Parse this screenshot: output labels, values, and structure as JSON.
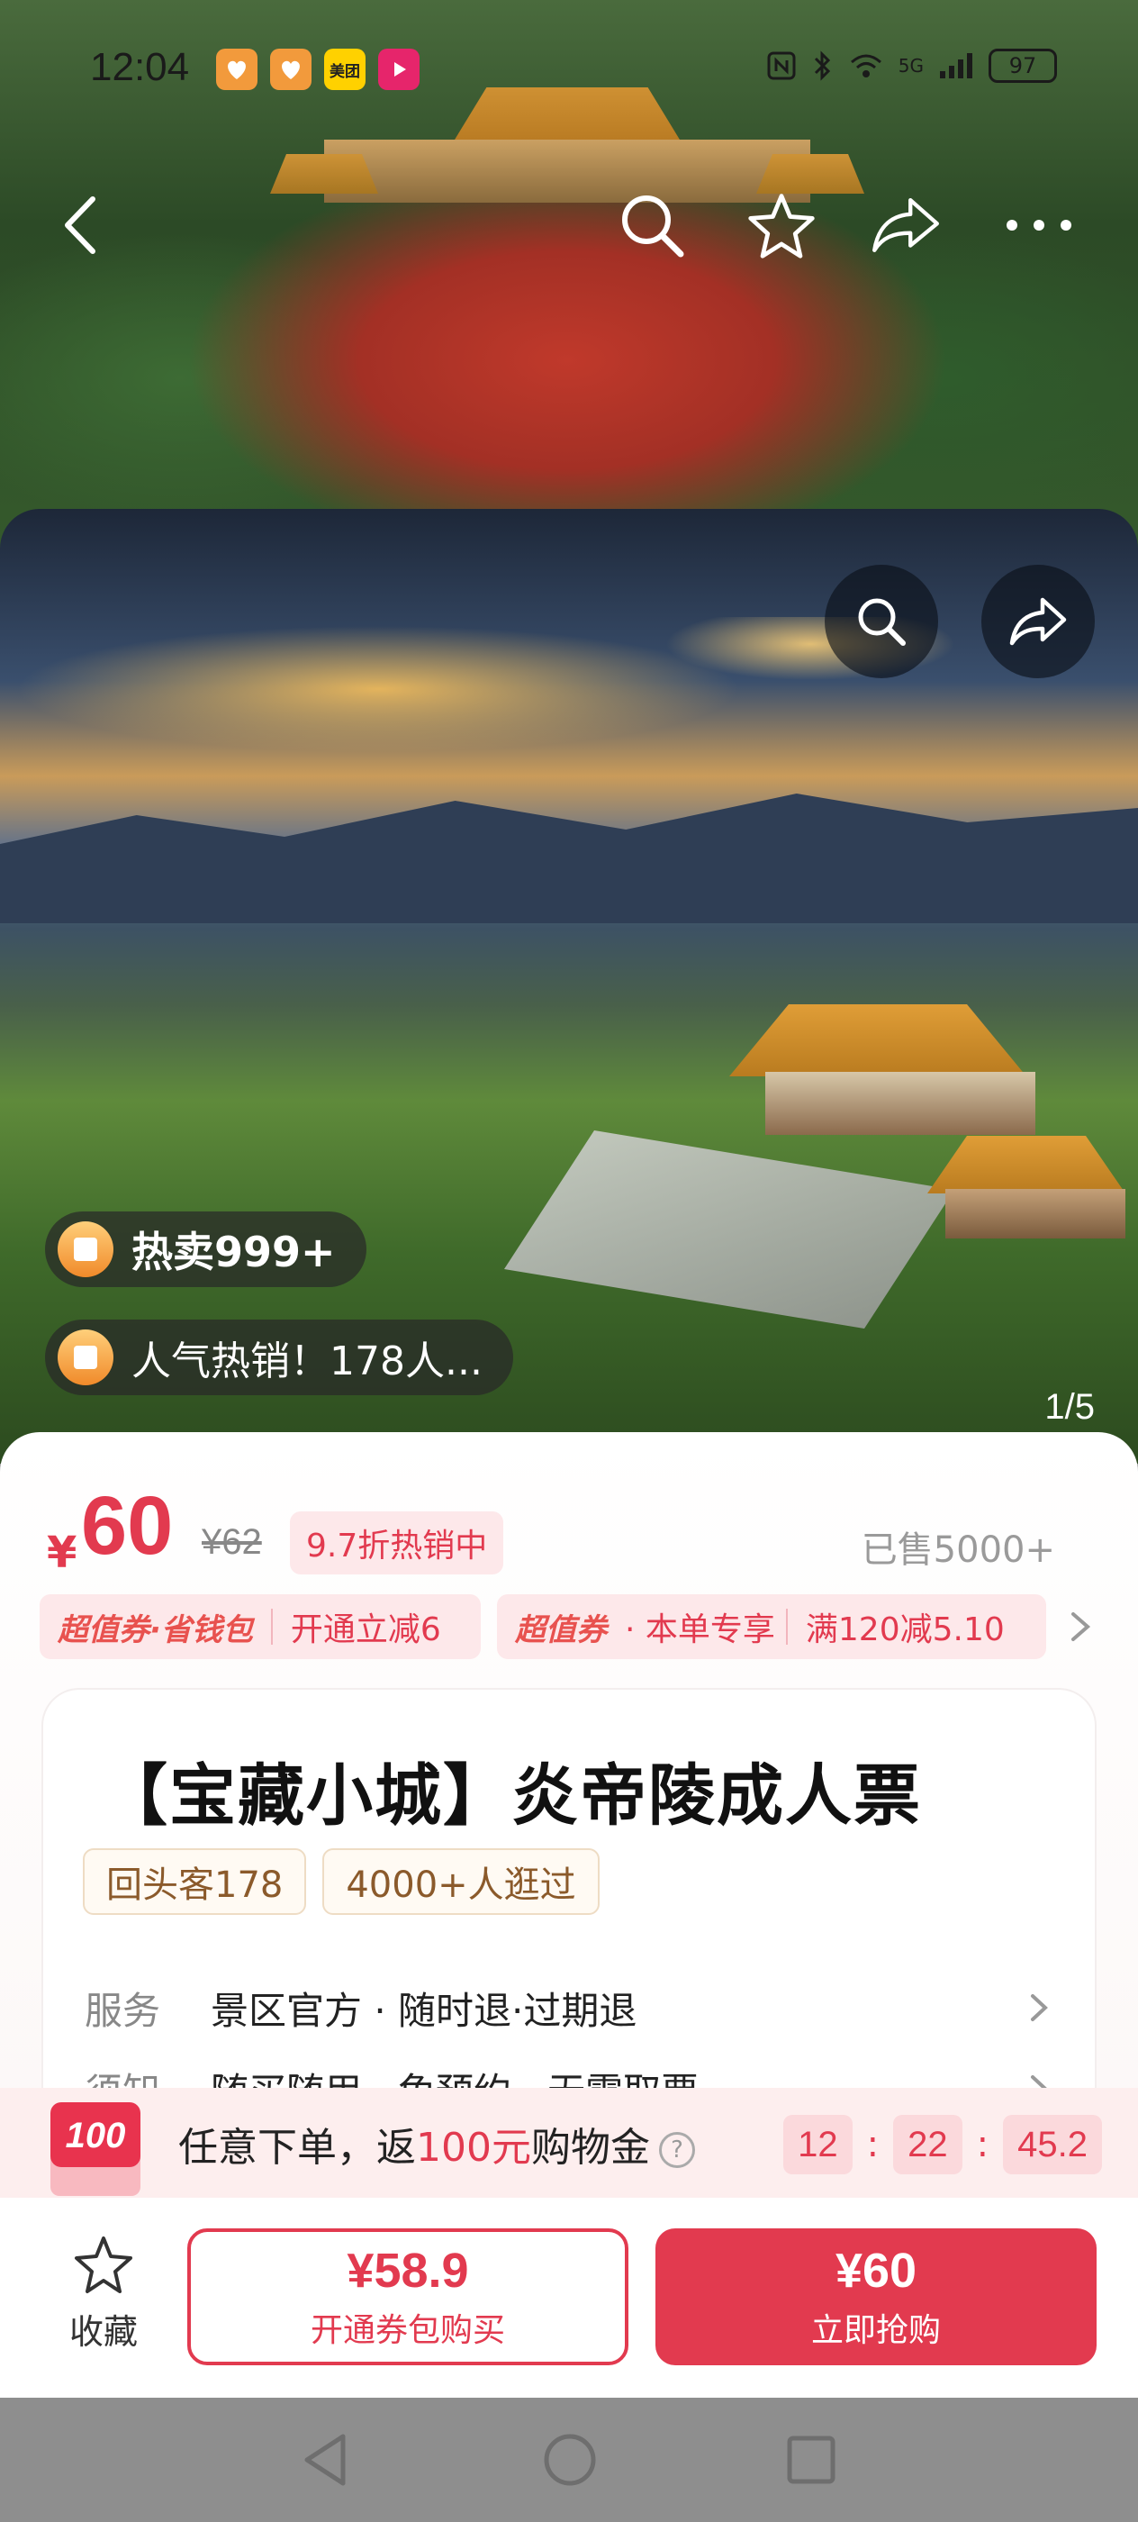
{
  "status_bar": {
    "time": "12:04",
    "apps": [
      "heart-app-icon",
      "heart-app-icon",
      "meituan-app-icon",
      "video-app-icon"
    ],
    "meituan_label": "美团",
    "battery": "97",
    "network": "5G"
  },
  "header": {
    "icons": [
      "back-icon",
      "search-icon",
      "star-icon",
      "share-icon",
      "more-icon"
    ]
  },
  "gallery": {
    "hot_badge": "热卖999+",
    "popularity_badge": "人气热销！178人...",
    "counter": "1/5"
  },
  "price": {
    "currency": "¥",
    "current": "60",
    "original": "¥62",
    "discount": "9.7折热销中",
    "sold": "已售5000+"
  },
  "coupons": [
    {
      "brand": "超值券·省钱包",
      "text": "开通立减6"
    },
    {
      "brand": "超值券",
      "text": "· 本单专享",
      "extra": "满120减5.10"
    }
  ],
  "product": {
    "title": "【宝藏小城】炎帝陵成人票",
    "tags": [
      "回头客178",
      "4000+人逛过"
    ],
    "rows": [
      {
        "key": "服务",
        "value": "景区官方 · 随时退·过期退"
      },
      {
        "key": "须知",
        "value": "随买随用 · 免预约 · 无需取票"
      }
    ]
  },
  "promo": {
    "badge": "100",
    "text_before": "任意下单，返",
    "text_highlight": "100元",
    "text_after": "购物金",
    "help": "?",
    "timer": [
      "12",
      "22",
      "45.2"
    ],
    "timer_sep": ":"
  },
  "actions": {
    "favorite": "收藏",
    "coupon_price": "¥58.9",
    "coupon_label": "开通券包购买",
    "buy_price": "¥60",
    "buy_label": "立即抢购"
  },
  "colors": {
    "accent": "#e23a4f",
    "price": "#e23a4f",
    "tag_text": "#8b5a2b"
  }
}
